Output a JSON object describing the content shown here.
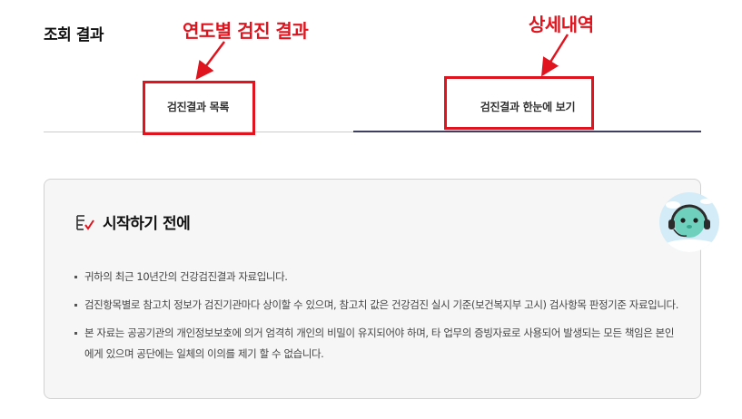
{
  "section": {
    "title": "조회 결과"
  },
  "annotations": {
    "first": "연도별 검진 결과",
    "second": "상세내역",
    "color": "#e0141e"
  },
  "tabs": [
    {
      "label": "검진결과 목록",
      "active": false
    },
    {
      "label": "검진결과 한눈에 보기",
      "active": true
    }
  ],
  "card": {
    "icon": "checklist-icon",
    "title": "시작하기 전에",
    "notes": [
      "귀하의 최근 10년간의 건강검진결과 자료입니다.",
      "검진항목별로 참고치 정보가 검진기관마다 상이할 수 있으며, 참고치 값은 건강검진 실시 기준(보건복지부 고시) 검사항목 판정기준 자료입니다.",
      "본 자료는 공공기관의 개인정보보호에 의거 엄격히 개인의 비밀이 유지되어야 하며, 타 업무의 증빙자료로 사용되어 발생되는 모든 책임은 본인에게 있으며 공단에는 일체의 이의를 제기 할 수 없습니다."
    ]
  },
  "mascot": {
    "icon": "headset-mascot-icon"
  },
  "colors": {
    "accent_red": "#e0141e",
    "active_tab_line": "#3f3f5f",
    "card_background": "#f6f6f6"
  }
}
